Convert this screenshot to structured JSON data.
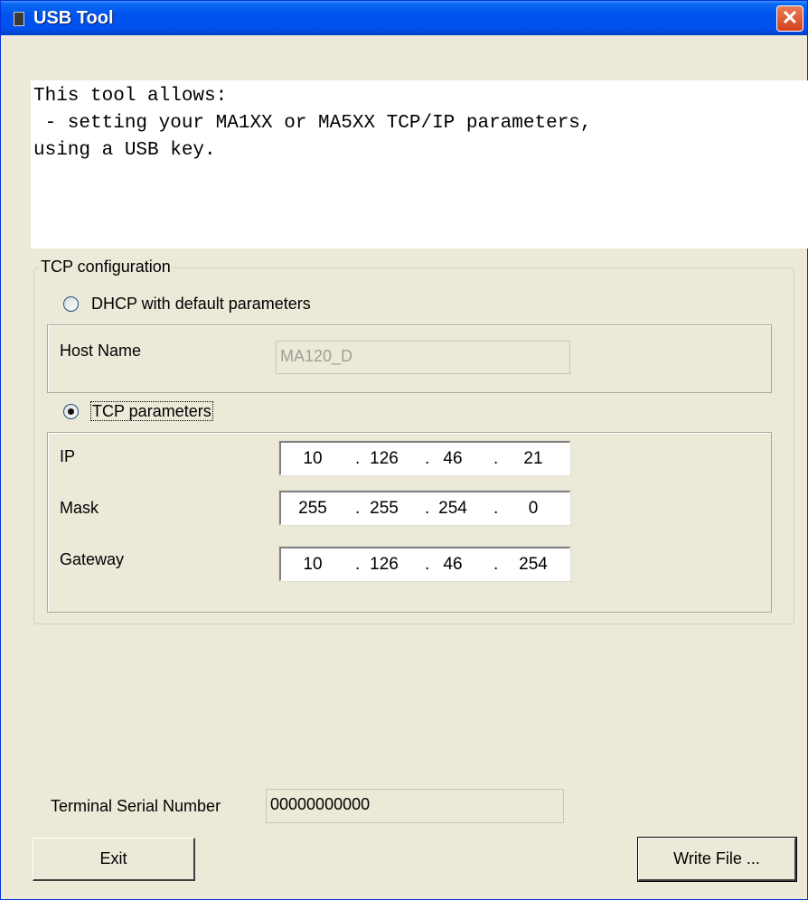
{
  "window": {
    "title": "USB Tool",
    "close_symbol": "✕"
  },
  "description": "This tool allows:\n - setting your MA1XX or MA5XX TCP/IP parameters,\nusing a USB key.",
  "tcp_config": {
    "legend": "TCP configuration",
    "dhcp": {
      "label": "DHCP with default parameters",
      "selected": false
    },
    "host_name": {
      "label": "Host Name",
      "value": "MA120_D"
    },
    "tcp_params": {
      "label": "TCP parameters",
      "selected": true
    },
    "ip": {
      "label": "IP",
      "octets": [
        "10",
        "126",
        "46",
        "21"
      ]
    },
    "mask": {
      "label": "Mask",
      "octets": [
        "255",
        "255",
        "254",
        "0"
      ]
    },
    "gateway": {
      "label": "Gateway",
      "octets": [
        "10",
        "126",
        "46",
        "254"
      ]
    }
  },
  "serial": {
    "label": "Terminal Serial Number",
    "value": "00000000000"
  },
  "buttons": {
    "exit": "Exit",
    "write": "Write File ..."
  },
  "colors": {
    "title_bar": "#0053ee",
    "window_bg": "#ece9d8",
    "close_button": "#d5411d"
  }
}
